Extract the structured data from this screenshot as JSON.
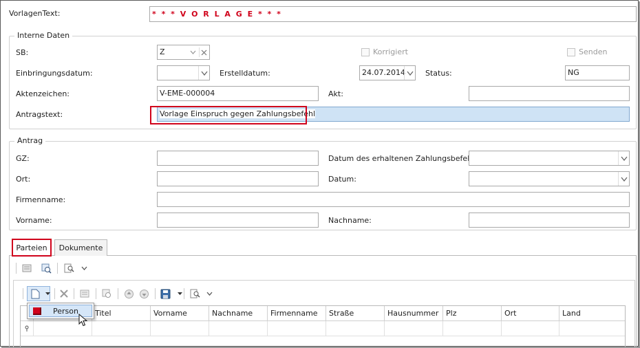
{
  "vorlagen_text": {
    "label": "VorlagenText:",
    "value": "* * *  V O R L A G E  * * *"
  },
  "interne_daten": {
    "title": "Interne Daten",
    "sb": {
      "label": "SB:",
      "value": "Z"
    },
    "korrigiert": {
      "label": "Korrigiert",
      "checked": false
    },
    "senden": {
      "label": "Senden",
      "checked": false
    },
    "einbringungsdatum": {
      "label": "Einbringungsdatum:",
      "value": ""
    },
    "erstelldatum": {
      "label": "Erstelldatum:",
      "value": "24.07.2014"
    },
    "status": {
      "label": "Status:",
      "value": "NG"
    },
    "aktenzeichen": {
      "label": "Aktenzeichen:",
      "value": "V-EME-000004"
    },
    "akt": {
      "label": "Akt:",
      "value": ""
    },
    "antragstext": {
      "label": "Antragstext:",
      "value": "Vorlage Einspruch gegen Zahlungsbefehl"
    }
  },
  "antrag": {
    "title": "Antrag",
    "gz": {
      "label": "GZ:",
      "value": ""
    },
    "datum_zahlungsbefehl": {
      "label": "Datum des erhaltenen Zahlungsbefehls:",
      "value": ""
    },
    "ort": {
      "label": "Ort:",
      "value": ""
    },
    "datum": {
      "label": "Datum:",
      "value": ""
    },
    "firmenname": {
      "label": "Firmenname:",
      "value": ""
    },
    "vorname": {
      "label": "Vorname:",
      "value": ""
    },
    "nachname": {
      "label": "Nachname:",
      "value": ""
    }
  },
  "tabs": [
    {
      "label": "Parteien",
      "active": true
    },
    {
      "label": "Dokumente",
      "active": false
    }
  ],
  "dropdown_menu": {
    "items": [
      {
        "label": "Person",
        "icon": "person-icon"
      }
    ]
  },
  "grid": {
    "columns": [
      "Titel",
      "Vorname",
      "Nachname",
      "Firmenname",
      "Straße",
      "Hausnummer",
      "Plz",
      "Ort",
      "Land"
    ]
  },
  "colors": {
    "accent_red": "#d0021b",
    "selection_blue": "#cfe3f5"
  }
}
